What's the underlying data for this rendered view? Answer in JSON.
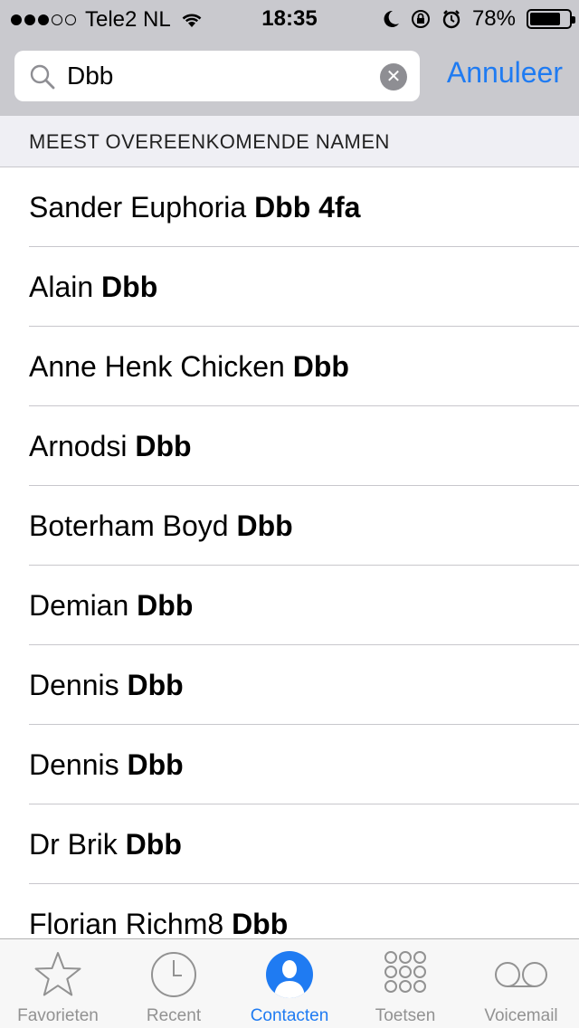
{
  "status_bar": {
    "carrier": "Tele2 NL",
    "time": "18:35",
    "battery": "78%",
    "battery_level": 0.78,
    "signal_bars_filled": 3,
    "signal_bars_total": 5
  },
  "search": {
    "value": "Dbb",
    "cancel_label": "Annuleer",
    "icon": "search-icon"
  },
  "section_header": "MEEST OVEREENKOMENDE NAMEN",
  "results": [
    {
      "first": "Sander Euphoria",
      "match": "Dbb 4fa"
    },
    {
      "first": "Alain",
      "match": "Dbb"
    },
    {
      "first": "Anne Henk Chicken",
      "match": "Dbb"
    },
    {
      "first": "Arnodsi",
      "match": "Dbb"
    },
    {
      "first": "Boterham Boyd",
      "match": "Dbb"
    },
    {
      "first": "Demian",
      "match": "Dbb"
    },
    {
      "first": "Dennis",
      "match": "Dbb"
    },
    {
      "first": "Dennis",
      "match": "Dbb"
    },
    {
      "first": "Dr Brik",
      "match": "Dbb"
    },
    {
      "first": "Florian Richm8",
      "match": "Dbb"
    }
  ],
  "tabs": [
    {
      "label": "Favorieten",
      "icon": "star-icon",
      "active": false
    },
    {
      "label": "Recent",
      "icon": "clock-icon",
      "active": false
    },
    {
      "label": "Contacten",
      "icon": "contact-icon",
      "active": true
    },
    {
      "label": "Toetsen",
      "icon": "keypad-icon",
      "active": false
    },
    {
      "label": "Voicemail",
      "icon": "voicemail-icon",
      "active": false
    }
  ],
  "colors": {
    "accent": "#1f7bf2",
    "inactive_tab": "#929292",
    "search_area_bg": "#c9c9ce",
    "section_bg": "#efeff4"
  }
}
